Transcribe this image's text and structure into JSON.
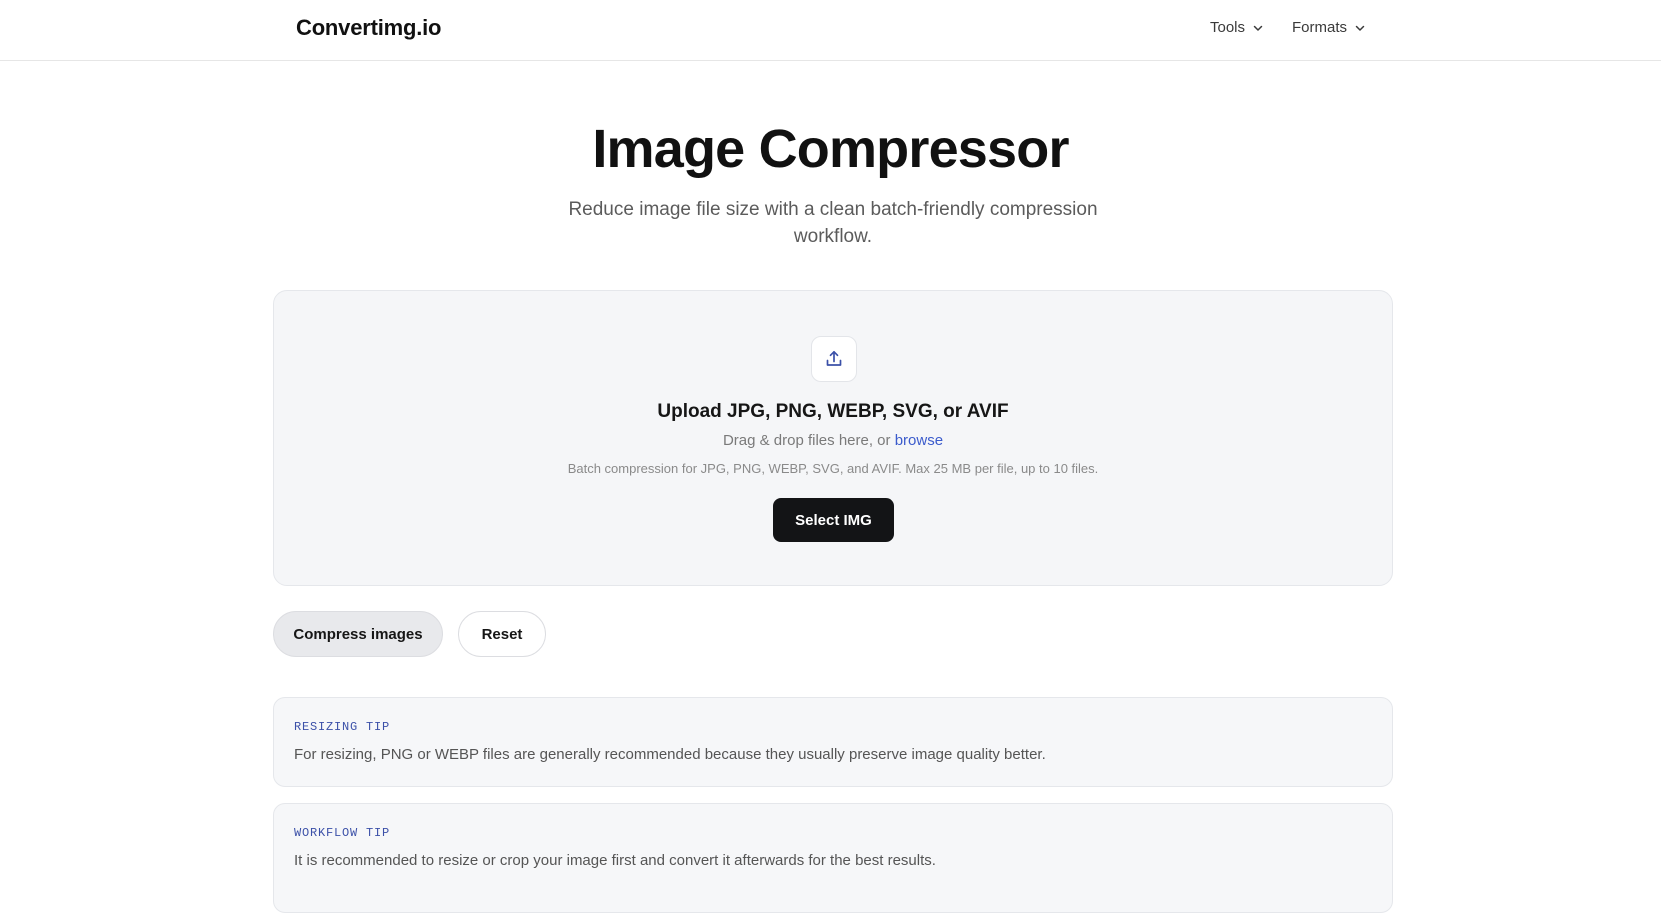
{
  "header": {
    "logo": "Convertimg.io",
    "nav": [
      {
        "label": "Tools",
        "icon": "chevron-down-icon"
      },
      {
        "label": "Formats",
        "icon": "chevron-down-icon"
      }
    ]
  },
  "hero": {
    "title": "Image Compressor",
    "subtitle": "Reduce image file size with a clean batch-friendly compression workflow."
  },
  "upload": {
    "icon": "upload-icon",
    "title": "Upload JPG, PNG, WEBP, SVG, or AVIF",
    "drag_text": "Drag & drop files here, or",
    "browse_label": "browse",
    "hint": "Batch compression for JPG, PNG, WEBP, SVG, and AVIF. Max 25 MB per file, up to 10 files.",
    "select_button": "Select IMG"
  },
  "actions": {
    "compress_label": "Compress images",
    "reset_label": "Reset"
  },
  "tips": [
    {
      "label": "RESIZING TIP",
      "text": "For resizing, PNG or WEBP files are generally recommended because they usually preserve image quality better."
    },
    {
      "label": "WORKFLOW TIP",
      "text": "It is recommended to resize or crop your image first and convert it afterwards for the best results."
    }
  ],
  "colors": {
    "accent": "#3b5bcc",
    "primary_button": "#131416",
    "panel_bg": "#f5f6f8",
    "tip_label": "#3b50a8"
  }
}
